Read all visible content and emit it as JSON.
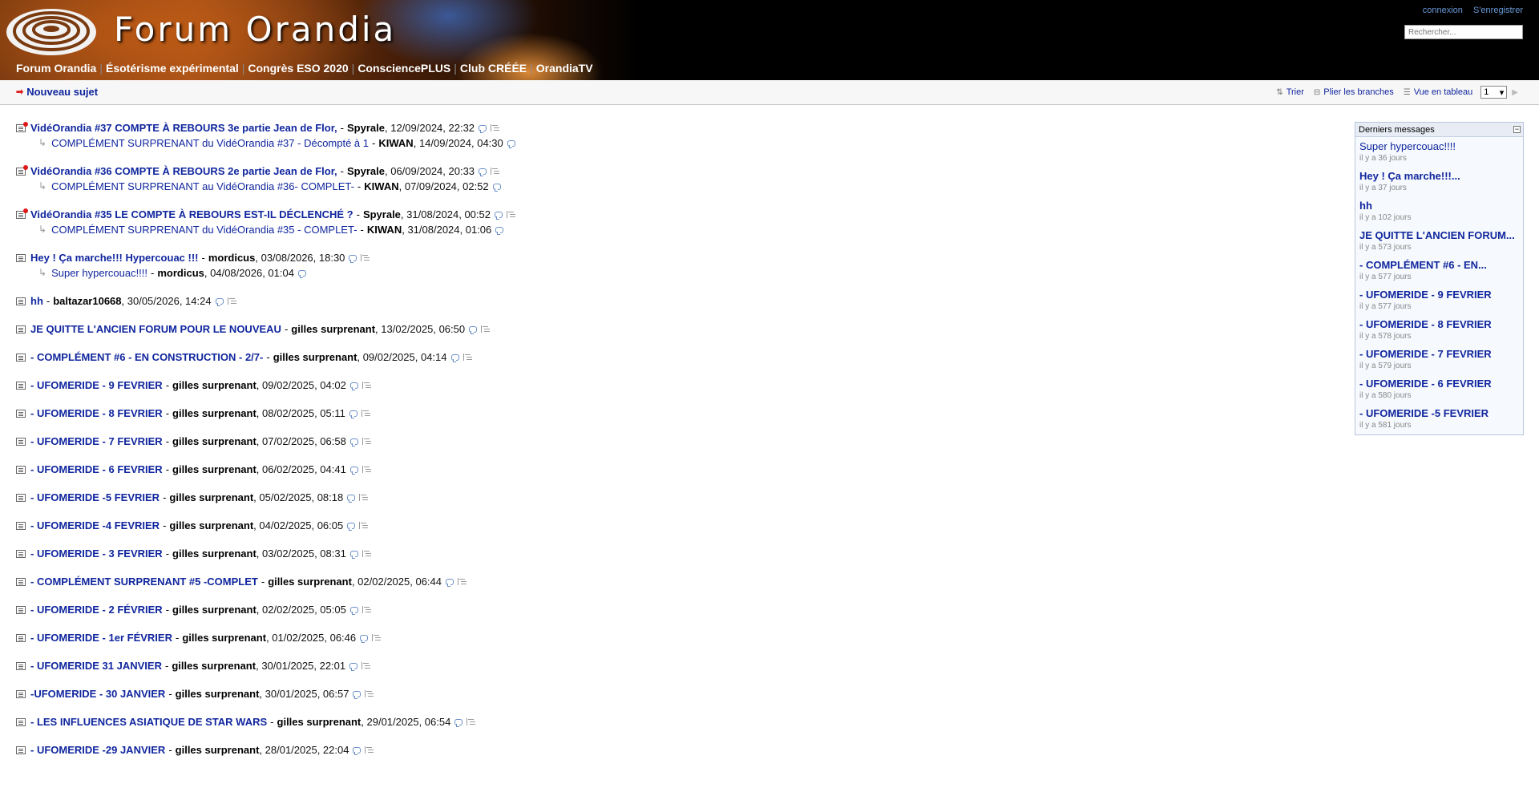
{
  "header": {
    "site_title": "Forum Orandia",
    "login": "connexion",
    "register": "S'enregistrer",
    "search_placeholder": "Rechercher...",
    "nav": [
      "Forum Orandia",
      "Ésotérisme expérimental",
      "Congrès ESO 2020",
      "ConsciencePLUS",
      "Club CRÉÉE",
      "OrandiaTV"
    ]
  },
  "toolbar": {
    "new_topic": "Nouveau sujet",
    "sort": "Trier",
    "fold": "Plier les branches",
    "table_view": "Vue en tableau",
    "page": "1"
  },
  "threads": [
    {
      "subject": "VidéOrandia #37 COMPTE À REBOURS 3e partie Jean de Flor,",
      "author": "Spyrale",
      "date": "12/09/2024, 22:32",
      "new": true,
      "replies": [
        {
          "subject": "COMPLÉMENT SURPRENANT du VidéOrandia #37 - Décompté à 1",
          "author": "KIWAN",
          "date": "14/09/2024, 04:30"
        }
      ]
    },
    {
      "subject": "VidéOrandia #36 COMPTE À REBOURS 2e partie Jean de Flor,",
      "author": "Spyrale",
      "date": "06/09/2024, 20:33",
      "new": true,
      "replies": [
        {
          "subject": "COMPLÉMENT SURPRENANT au VidéOrandia #36- COMPLET-",
          "author": "KIWAN",
          "date": "07/09/2024, 02:52"
        }
      ]
    },
    {
      "subject": "VidéOrandia #35 LE COMPTE À REBOURS EST-IL DÉCLENCHÉ ?",
      "author": "Spyrale",
      "date": "31/08/2024, 00:52",
      "new": true,
      "replies": [
        {
          "subject": "COMPLÉMENT SURPRENANT du VidéOrandia #35 - COMPLET-",
          "author": "KIWAN",
          "date": "31/08/2024, 01:06"
        }
      ]
    },
    {
      "subject": "Hey ! Ça marche!!! Hypercouac !!!",
      "author": "mordicus",
      "date": "03/08/2026, 18:30",
      "new": false,
      "replies": [
        {
          "subject": "Super hypercouac!!!!",
          "author": "mordicus",
          "date": "04/08/2026, 01:04"
        }
      ]
    },
    {
      "subject": "hh",
      "author": "baltazar10668",
      "date": "30/05/2026, 14:24",
      "new": false,
      "replies": []
    },
    {
      "subject": "JE QUITTE L'ANCIEN FORUM POUR LE NOUVEAU",
      "author": "gilles surprenant",
      "date": "13/02/2025, 06:50",
      "new": false,
      "replies": []
    },
    {
      "subject": "- COMPLÉMENT #6 - EN CONSTRUCTION - 2/7-",
      "author": "gilles surprenant",
      "date": "09/02/2025, 04:14",
      "new": false,
      "replies": []
    },
    {
      "subject": "- UFOMERIDE - 9 FEVRIER",
      "author": "gilles surprenant",
      "date": "09/02/2025, 04:02",
      "new": false,
      "replies": []
    },
    {
      "subject": "- UFOMERIDE - 8 FEVRIER",
      "author": "gilles surprenant",
      "date": "08/02/2025, 05:11",
      "new": false,
      "replies": []
    },
    {
      "subject": "- UFOMERIDE - 7 FEVRIER",
      "author": "gilles surprenant",
      "date": "07/02/2025, 06:58",
      "new": false,
      "replies": []
    },
    {
      "subject": "- UFOMERIDE - 6 FEVRIER",
      "author": "gilles surprenant",
      "date": "06/02/2025, 04:41",
      "new": false,
      "replies": []
    },
    {
      "subject": "- UFOMERIDE -5 FEVRIER",
      "author": "gilles surprenant",
      "date": "05/02/2025, 08:18",
      "new": false,
      "replies": []
    },
    {
      "subject": "- UFOMERIDE -4 FEVRIER",
      "author": "gilles surprenant",
      "date": "04/02/2025, 06:05",
      "new": false,
      "replies": []
    },
    {
      "subject": "- UFOMERIDE - 3 FEVRIER",
      "author": "gilles surprenant",
      "date": "03/02/2025, 08:31",
      "new": false,
      "replies": []
    },
    {
      "subject": "- COMPLÉMENT SURPRENANT #5 -COMPLET",
      "author": "gilles surprenant",
      "date": "02/02/2025, 06:44",
      "new": false,
      "replies": []
    },
    {
      "subject": "- UFOMERIDE - 2 FÉVRIER",
      "author": "gilles surprenant",
      "date": "02/02/2025, 05:05",
      "new": false,
      "replies": []
    },
    {
      "subject": "- UFOMERIDE - 1er FÉVRIER",
      "author": "gilles surprenant",
      "date": "01/02/2025, 06:46",
      "new": false,
      "replies": []
    },
    {
      "subject": "- UFOMERIDE 31 JANVIER",
      "author": "gilles surprenant",
      "date": "30/01/2025, 22:01",
      "new": false,
      "replies": []
    },
    {
      "subject": "-UFOMERIDE - 30 JANVIER",
      "author": "gilles surprenant",
      "date": "30/01/2025, 06:57",
      "new": false,
      "replies": []
    },
    {
      "subject": "- LES INFLUENCES ASIATIQUE DE STAR WARS",
      "author": "gilles surprenant",
      "date": "29/01/2025, 06:54",
      "new": false,
      "replies": []
    },
    {
      "subject": "- UFOMERIDE -29 JANVIER",
      "author": "gilles surprenant",
      "date": "28/01/2025, 22:04",
      "new": false,
      "replies": []
    }
  ],
  "sidebar": {
    "title": "Derniers messages",
    "items": [
      {
        "title": "Super hypercouac!!!!",
        "ago": "il y a 36 jours",
        "bold": false
      },
      {
        "title": "Hey ! Ça marche!!!...",
        "ago": "il y a 37 jours",
        "bold": true
      },
      {
        "title": "hh",
        "ago": "il y a 102 jours",
        "bold": true
      },
      {
        "title": "JE QUITTE L'ANCIEN FORUM...",
        "ago": "il y a 573 jours",
        "bold": true
      },
      {
        "title": "- COMPLÉMENT #6 - EN...",
        "ago": "il y a 577 jours",
        "bold": true
      },
      {
        "title": "- UFOMERIDE - 9 FEVRIER",
        "ago": "il y a 577 jours",
        "bold": true
      },
      {
        "title": "- UFOMERIDE - 8 FEVRIER",
        "ago": "il y a 578 jours",
        "bold": true
      },
      {
        "title": "- UFOMERIDE - 7 FEVRIER",
        "ago": "il y a 579 jours",
        "bold": true
      },
      {
        "title": "- UFOMERIDE - 6 FEVRIER",
        "ago": "il y a 580 jours",
        "bold": true
      },
      {
        "title": "- UFOMERIDE -5 FEVRIER",
        "ago": "il y a 581 jours",
        "bold": true
      }
    ]
  }
}
